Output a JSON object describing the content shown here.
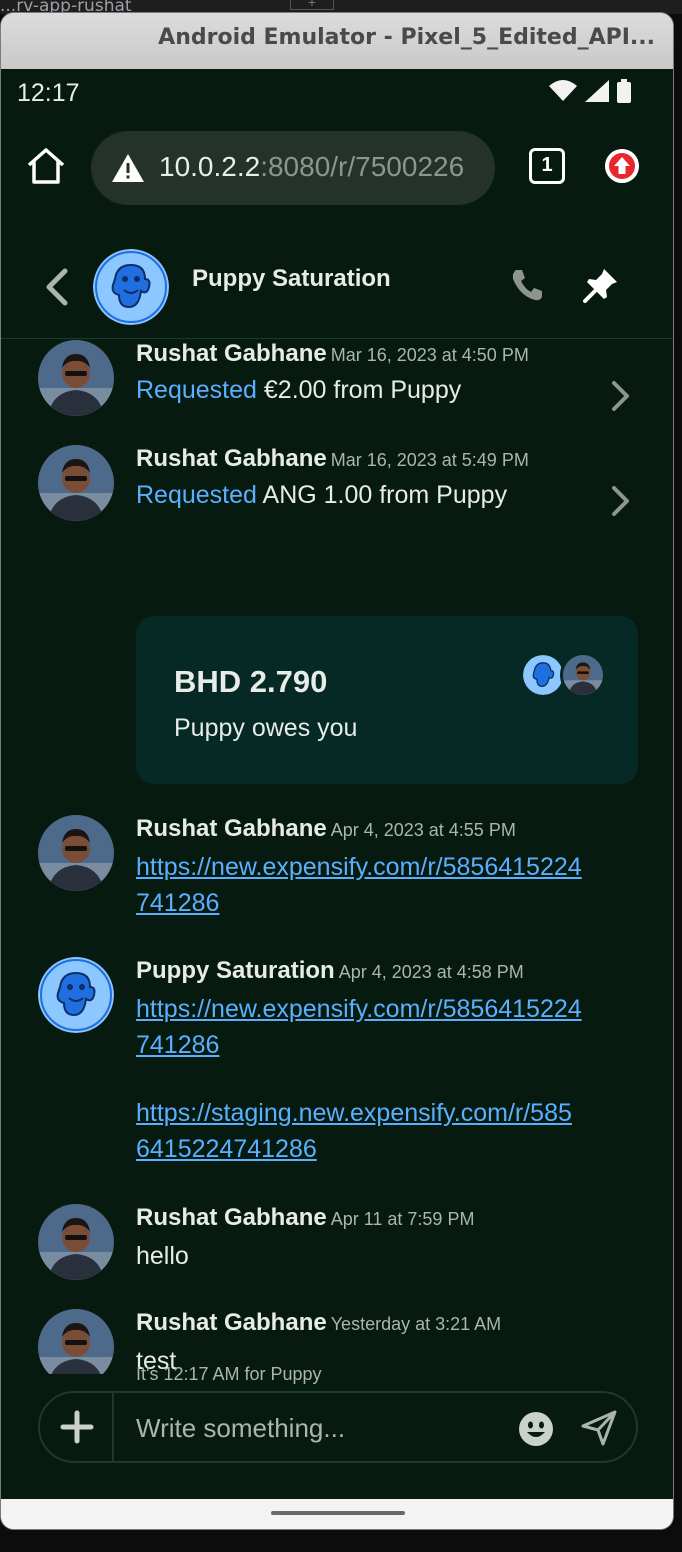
{
  "host": {
    "tab_text": "...rv-app-rushat"
  },
  "emulator": {
    "title": "Android Emulator - Pixel_5_Edited_API..."
  },
  "status_bar": {
    "time": "12:17"
  },
  "browser": {
    "url_host": "10.0.2.2",
    "url_rest": ":8080/r/7500226",
    "tab_count": "1"
  },
  "chat": {
    "title": "Puppy Saturation",
    "messages": [
      {
        "author": "Rushat Gabhane",
        "timestamp": "Mar 16, 2023 at 4:50 PM",
        "requested_word": "Requested",
        "text": "€2.00 from Puppy"
      },
      {
        "author": "Rushat Gabhane",
        "timestamp": "Mar 16, 2023 at 5:49 PM",
        "requested_word": "Requested",
        "text": "ANG 1.00 from Puppy"
      },
      {
        "author": "Rushat Gabhane",
        "timestamp": "Apr 4, 2023 at 4:55 PM",
        "link_line1": "https://new.expensify.com/r/5856415224",
        "link_line2": "741286"
      },
      {
        "author": "Puppy Saturation",
        "timestamp": "Apr 4, 2023 at 4:58 PM",
        "link_line1": "https://new.expensify.com/r/5856415224",
        "link_line2": "741286",
        "link2_line1": "https://staging.new.expensify.com/r/585",
        "link2_line2": "6415224741286"
      },
      {
        "author": "Rushat Gabhane",
        "timestamp": "Apr 11 at 7:59 PM",
        "text": "hello"
      },
      {
        "author": "Rushat Gabhane",
        "timestamp": "Yesterday at 3:21 AM",
        "text": "test"
      }
    ],
    "iou": {
      "amount": "BHD 2.790",
      "subtitle": "Puppy owes you"
    },
    "local_time_note": "It's 12:17 AM for Puppy",
    "composer": {
      "placeholder": "Write something..."
    }
  },
  "colors": {
    "background": "#061a10",
    "accent_link": "#5ab0ff",
    "card": "#072925",
    "puppy_avatar": "#8cc7ff",
    "puppy_figure": "#1f6fe0"
  },
  "icons": [
    "home-icon",
    "warning-icon",
    "tabs-icon",
    "update-icon",
    "back-icon",
    "phone-icon",
    "pin-icon",
    "chevron-right-icon",
    "plus-icon",
    "emoji-icon",
    "send-icon",
    "wifi-icon",
    "signal-icon",
    "battery-icon"
  ]
}
